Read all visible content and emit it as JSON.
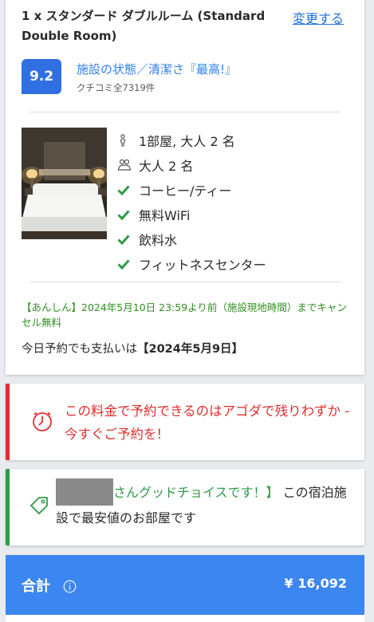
{
  "room": {
    "title": "1 x スタンダード ダブルルーム (Standard Double Room)",
    "change_link": "変更する",
    "score": "9.2",
    "score_label": "施設の状態／清潔さ『最高!』",
    "reviews": "クチコミ全7319件",
    "amenities": [
      {
        "icon": "person-icon",
        "text": "1部屋, 大人 2 名"
      },
      {
        "icon": "bed-icon",
        "text": "大人 2 名"
      },
      {
        "icon": "check-icon",
        "text": "コーヒー/ティー"
      },
      {
        "icon": "check-icon",
        "text": "無料WiFi"
      },
      {
        "icon": "check-icon",
        "text": "飲料水"
      },
      {
        "icon": "check-icon",
        "text": "フィットネスセンター"
      }
    ],
    "cancellation": "【あんしん】2024年5月10日 23:59より前（施設現地時間）までキャンセル無料",
    "pay_prefix": "今日予約でも支払いは",
    "pay_date": "【2024年5月9日】"
  },
  "alert": {
    "text": "この料金で予約できるのはアゴダで残りわずか - 今すぐご予約を!"
  },
  "good_choice": {
    "highlight": "さんグッドチョイスです！】",
    "rest": " この宿泊施設で最安値のお部屋です"
  },
  "total": {
    "label": "合計",
    "price": "¥ 16,092"
  },
  "colors": {
    "score_bg": "#2f6fe1",
    "link": "#1f6fd6",
    "cancel_green": "#2f8f1f",
    "alert_red": "#e12d2d",
    "good_green": "#2f9a46",
    "total_bar": "#3b86f0"
  }
}
